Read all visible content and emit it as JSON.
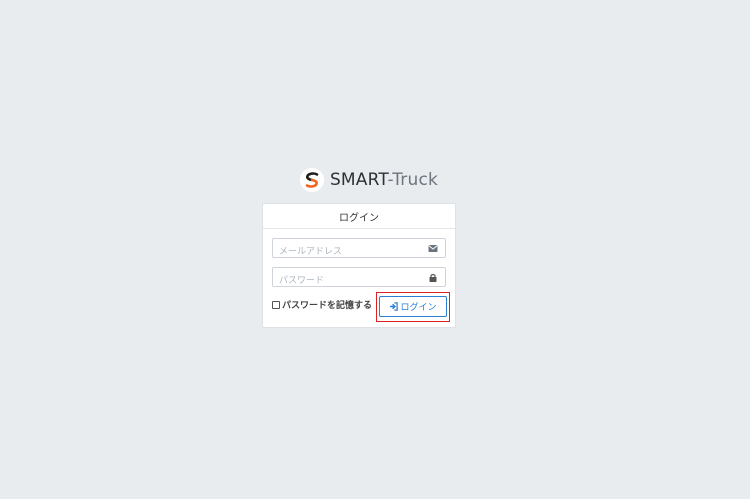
{
  "brand": {
    "name_main": "SMART",
    "name_suffix": "-Truck",
    "logo_icon": "smart-truck-logo-icon"
  },
  "login_card": {
    "title": "ログイン",
    "email": {
      "placeholder": "メールアドレス",
      "value": "",
      "icon": "envelope-icon"
    },
    "password": {
      "placeholder": "パスワード",
      "value": "",
      "icon": "lock-icon"
    },
    "remember_label": "パスワードを記憶する",
    "remember_checked": false,
    "submit_label": "ログイン",
    "submit_icon": "sign-in-icon"
  },
  "colors": {
    "background": "#e9ecef",
    "accent": "#2a7fd4",
    "highlight": "#e02020",
    "logo_orange": "#f26522"
  }
}
